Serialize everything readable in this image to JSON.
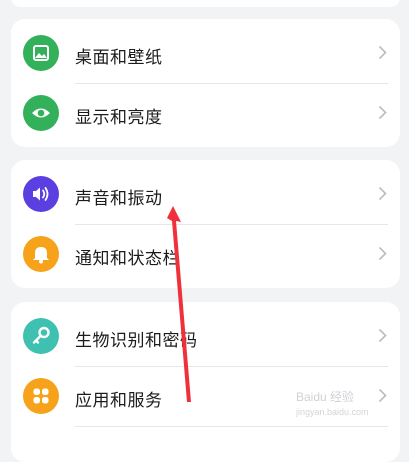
{
  "settings": {
    "group_1": [
      {
        "label": "桌面和壁纸",
        "icon": "image-icon",
        "color": "#33b05a"
      },
      {
        "label": "显示和亮度",
        "icon": "eye-icon",
        "color": "#33b05a"
      }
    ],
    "group_2": [
      {
        "label": "声音和振动",
        "icon": "speaker-icon",
        "color": "#5b3fe0"
      },
      {
        "label": "通知和状态栏",
        "icon": "bell-icon",
        "color": "#f6a31b"
      }
    ],
    "group_3": [
      {
        "label": "生物识别和密码",
        "icon": "key-icon",
        "color": "#3fc1b2"
      },
      {
        "label": "应用和服务",
        "icon": "apps-grid-icon",
        "color": "#f6a31b"
      }
    ]
  },
  "annotation": {
    "arrow_color": "#f0303a"
  },
  "watermark": {
    "text": "Baidu 经验",
    "sub": "jingyan.baidu.com"
  }
}
